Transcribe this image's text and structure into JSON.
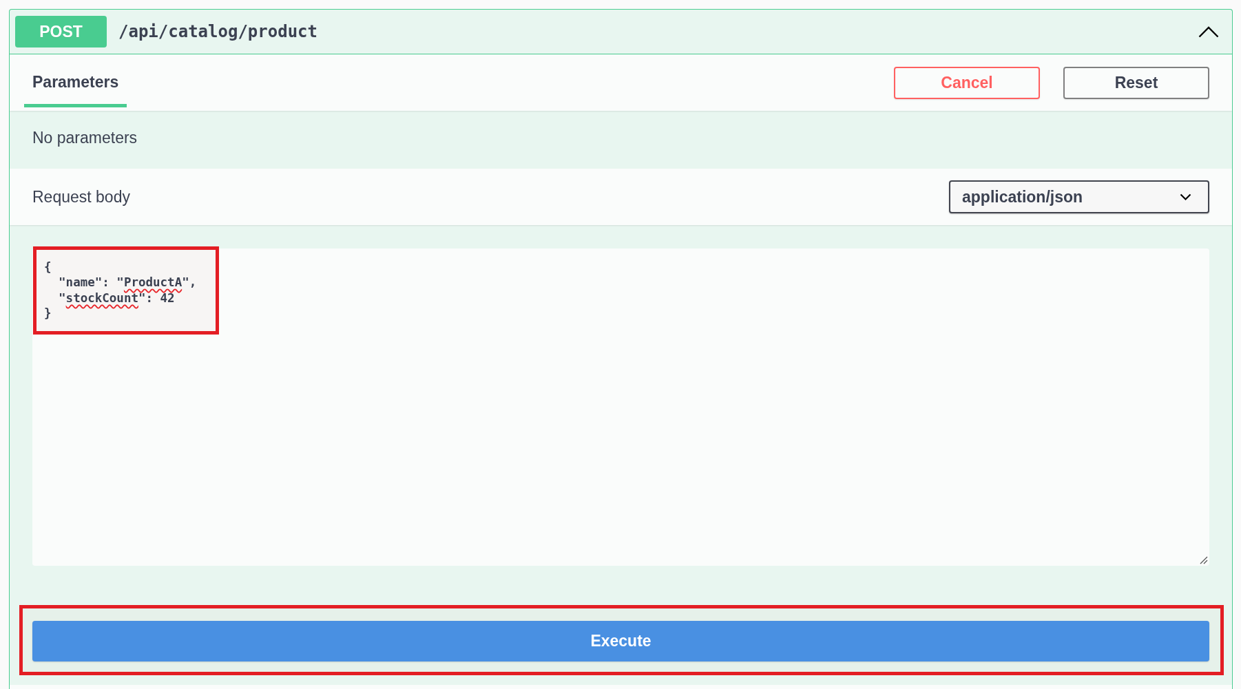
{
  "operation": {
    "method": "POST",
    "path": "/api/catalog/product",
    "expanded": true
  },
  "tabs": [
    {
      "label": "Parameters",
      "selected": true
    }
  ],
  "actions": [
    {
      "label": "Cancel",
      "kind": "cancel"
    },
    {
      "label": "Reset",
      "kind": "reset"
    }
  ],
  "parameters": {
    "message": "No parameters"
  },
  "request_body": {
    "label": "Request body",
    "content_type": "application/json",
    "highlighted": true,
    "lines": [
      {
        "tokens": [
          {
            "text": "{",
            "kind": "plain"
          }
        ]
      },
      {
        "tokens": [
          {
            "text": "  \"name\": \"",
            "kind": "plain"
          },
          {
            "text": "ProductA",
            "kind": "misspelled"
          },
          {
            "text": "\",",
            "kind": "plain"
          }
        ]
      },
      {
        "tokens": [
          {
            "text": "  \"",
            "kind": "plain"
          },
          {
            "text": "stockCount",
            "kind": "misspelled"
          },
          {
            "text": "\": 42",
            "kind": "plain"
          }
        ]
      },
      {
        "tokens": [
          {
            "text": "}",
            "kind": "plain"
          }
        ]
      }
    ]
  },
  "execute": {
    "label": "Execute",
    "highlighted": true
  }
}
